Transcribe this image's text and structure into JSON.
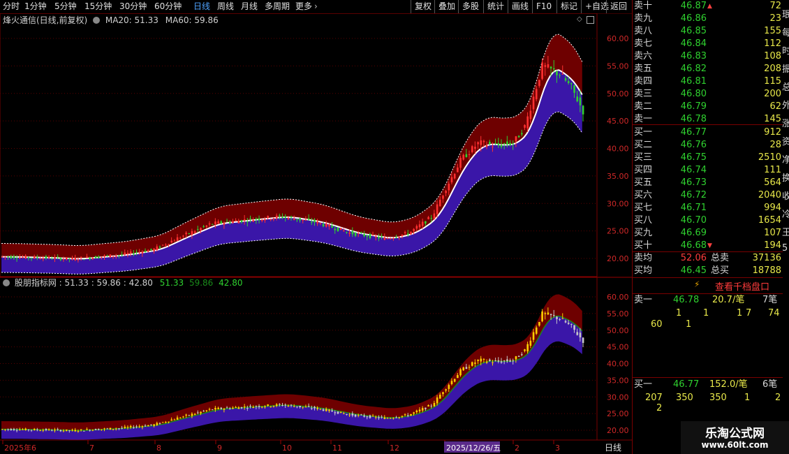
{
  "toolbar": {
    "periods": [
      "分时",
      "1分钟",
      "5分钟",
      "15分钟",
      "30分钟",
      "60分钟",
      "日线",
      "周线",
      "月线",
      "多周期",
      "更多"
    ],
    "active_period": "日线",
    "actions": [
      "复权",
      "叠加",
      "多股",
      "统计",
      "画线",
      "F10",
      "标记",
      "+自选",
      "返回"
    ]
  },
  "main_panel": {
    "title": "烽火通信(日线,前复权)",
    "ma20": "MA20: 51.33",
    "ma60": "MA60: 59.86"
  },
  "sub_panel": {
    "title": "股朋指标网",
    "values": ": 51.33 : 59.86 : 42.80",
    "v1": "51.33",
    "v2": "59.86",
    "v3": "42.80",
    "colors": {
      "v1": "#2fd12f",
      "v2": "#1a8a1a",
      "v3": "#2fd12f"
    }
  },
  "axes": {
    "main_y_ticks": [
      "60.00",
      "55.00",
      "50.00",
      "45.00",
      "40.00",
      "35.00",
      "30.00",
      "25.00",
      "20.00"
    ],
    "sub_y_ticks": [
      "60.00",
      "55.00",
      "50.00",
      "45.00",
      "40.00",
      "35.00",
      "30.00",
      "25.00",
      "20.00"
    ],
    "x_ticks": [
      "2025年6",
      "7",
      "8",
      "9",
      "10",
      "11",
      "12",
      "2025/12/26/五",
      "2",
      "3"
    ],
    "x_mode": "日线"
  },
  "order_book": {
    "sell": [
      {
        "label": "卖十",
        "price": "46.87",
        "vol": "72",
        "mark": "up"
      },
      {
        "label": "卖九",
        "price": "46.86",
        "vol": "23"
      },
      {
        "label": "卖八",
        "price": "46.85",
        "vol": "155"
      },
      {
        "label": "卖七",
        "price": "46.84",
        "vol": "112"
      },
      {
        "label": "卖六",
        "price": "46.83",
        "vol": "108"
      },
      {
        "label": "卖五",
        "price": "46.82",
        "vol": "208"
      },
      {
        "label": "卖四",
        "price": "46.81",
        "vol": "115"
      },
      {
        "label": "卖三",
        "price": "46.80",
        "vol": "200"
      },
      {
        "label": "卖二",
        "price": "46.79",
        "vol": "62"
      },
      {
        "label": "卖一",
        "price": "46.78",
        "vol": "145"
      }
    ],
    "buy": [
      {
        "label": "买一",
        "price": "46.77",
        "vol": "912"
      },
      {
        "label": "买二",
        "price": "46.76",
        "vol": "28"
      },
      {
        "label": "买三",
        "price": "46.75",
        "vol": "2510"
      },
      {
        "label": "买四",
        "price": "46.74",
        "vol": "111"
      },
      {
        "label": "买五",
        "price": "46.73",
        "vol": "564"
      },
      {
        "label": "买六",
        "price": "46.72",
        "vol": "2040"
      },
      {
        "label": "买七",
        "price": "46.71",
        "vol": "994"
      },
      {
        "label": "买八",
        "price": "46.70",
        "vol": "1654"
      },
      {
        "label": "买九",
        "price": "46.69",
        "vol": "107"
      },
      {
        "label": "买十",
        "price": "46.68",
        "vol": "194",
        "mark": "down"
      }
    ],
    "sell_avg": {
      "label": "卖均",
      "price": "52.06",
      "total_label": "总卖",
      "total": "37136"
    },
    "buy_avg": {
      "label": "买均",
      "price": "46.45",
      "total_label": "总买",
      "total": "18788"
    }
  },
  "thousand": {
    "button": "查看千档盘口"
  },
  "queue": {
    "sell1": {
      "label": "卖一",
      "price": "46.78",
      "amount": "20.7/笔",
      "count": "7笔",
      "orders": [
        "1",
        "1",
        "1",
        "7",
        "74",
        "60",
        "1"
      ]
    },
    "buy1": {
      "label": "买一",
      "price": "46.77",
      "amount": "152.0/笔",
      "count": "6笔",
      "orders": [
        "207",
        "350",
        "350",
        "1",
        "2",
        "2"
      ]
    }
  },
  "stripe_chars": [
    "珉",
    "每",
    "时",
    "振",
    "总",
    "外",
    "涨",
    "资",
    "净",
    "换",
    "收",
    "冷",
    "王",
    "5"
  ],
  "watermark": {
    "line1": "乐淘公式网",
    "line2": "www.60lt.com"
  },
  "chart_data": {
    "type": "candlestick",
    "title": "烽火通信(日线,前复权)",
    "ylim": [
      18,
      62
    ],
    "x_labels": [
      "2025年6",
      "7",
      "8",
      "9",
      "10",
      "11",
      "12",
      "2025/12/26/五",
      "2",
      "3"
    ],
    "monthly_close": [
      20.3,
      21.0,
      23.5,
      28.5,
      29.5,
      26.5,
      24.0,
      32.0,
      44.0,
      46.8
    ],
    "last": 46.77
  }
}
